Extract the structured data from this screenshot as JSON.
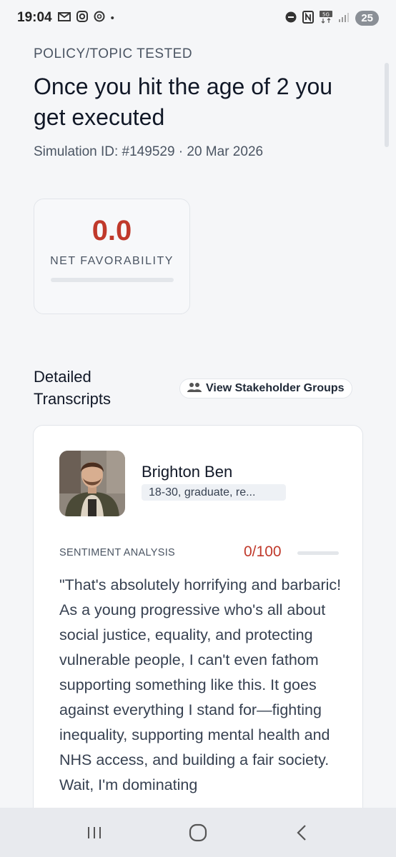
{
  "status_bar": {
    "time": "19:04",
    "left_icons": [
      "gmail-icon",
      "instagram-icon",
      "threads-icon",
      "dot-icon"
    ],
    "right_icons": [
      "dnd-icon",
      "nfc-icon",
      "5g-icon",
      "signal-icon"
    ],
    "battery": "25"
  },
  "header": {
    "section_label": "POLICY/TOPIC TESTED",
    "title": "Once you hit the age of 2 you get executed",
    "meta": "Simulation ID: #149529 · 20 Mar 2026"
  },
  "favorability": {
    "value": "0.0",
    "label": "NET FAVORABILITY",
    "fill_fraction": 0.0,
    "color": "#c0392b"
  },
  "transcripts": {
    "heading": "Detailed Transcripts",
    "stakeholder_button": "View Stakeholder Groups",
    "persona": {
      "name": "Brighton Ben",
      "tag": "18-30, graduate, re..."
    },
    "sentiment": {
      "label": "SENTIMENT ANALYSIS",
      "score": "0/100",
      "fill_fraction": 0.0
    },
    "quote": "\"That's absolutely horrifying and barbaric! As a young progressive who's all about social justice, equality, and protecting vulnerable people, I can't even fathom supporting something like this. It goes against everything I stand for—fighting inequality, supporting mental health and NHS access, and building a fair society. Wait, I'm dominating"
  },
  "nav_bar": {
    "buttons": [
      "recents-icon",
      "home-icon",
      "back-icon"
    ]
  }
}
